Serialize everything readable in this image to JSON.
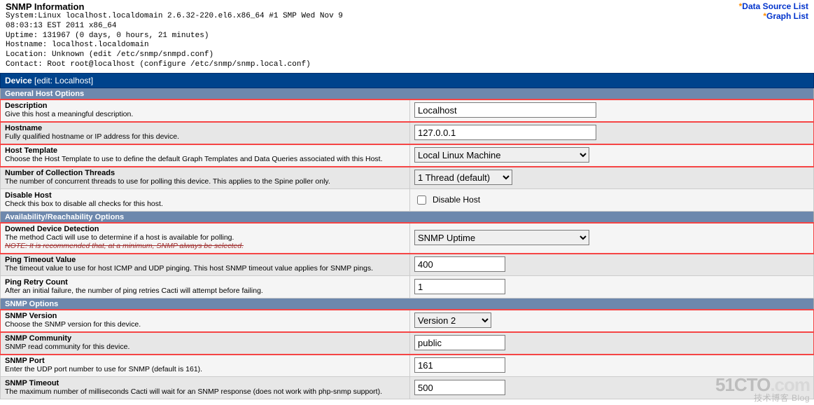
{
  "top_links": {
    "data_source_list": "Data Source List",
    "graph_list": "Graph List"
  },
  "snmp": {
    "title": "SNMP Information",
    "system_line1": "System:Linux localhost.localdomain 2.6.32-220.el6.x86_64 #1 SMP Wed Nov 9",
    "system_line2": "08:03:13 EST 2011 x86_64",
    "uptime": "Uptime: 131967 (0 days, 0 hours, 21 minutes)",
    "hostname": "Hostname: localhost.localdomain",
    "location": "Location: Unknown (edit /etc/snmp/snmpd.conf)",
    "contact": "Contact: Root root@localhost (configure /etc/snmp/snmp.local.conf)"
  },
  "device_bar": {
    "prefix": "Device ",
    "edit": "[edit: Localhost]"
  },
  "sections": {
    "general": "General Host Options",
    "avail": "Availability/Reachability Options",
    "snmp": "SNMP Options"
  },
  "fields": {
    "description": {
      "label": "Description",
      "hint": "Give this host a meaningful description.",
      "value": "Localhost"
    },
    "hostname": {
      "label": "Hostname",
      "hint": "Fully qualified hostname or IP address for this device.",
      "value": "127.0.0.1"
    },
    "host_template": {
      "label": "Host Template",
      "hint": "Choose the Host Template to use to define the default Graph Templates and Data Queries associated with this Host.",
      "value": "Local Linux Machine"
    },
    "threads": {
      "label": "Number of Collection Threads",
      "hint": "The number of concurrent threads to use for polling this device. This applies to the Spine poller only.",
      "value": "1 Thread (default)"
    },
    "disable": {
      "label": "Disable Host",
      "hint": "Check this box to disable all checks for this host.",
      "cb_label": "Disable Host"
    },
    "downed": {
      "label": "Downed Device Detection",
      "hint": "The method Cacti will use to determine if a host is available for polling.",
      "note": "NOTE: It is recommended that, at a minimum, SNMP always be selected.",
      "value": "SNMP Uptime"
    },
    "ping_timeout": {
      "label": "Ping Timeout Value",
      "hint": "The timeout value to use for host ICMP and UDP pinging. This host SNMP timeout value applies for SNMP pings.",
      "value": "400"
    },
    "ping_retry": {
      "label": "Ping Retry Count",
      "hint": "After an initial failure, the number of ping retries Cacti will attempt before failing.",
      "value": "1"
    },
    "snmp_version": {
      "label": "SNMP Version",
      "hint": "Choose the SNMP version for this device.",
      "value": "Version 2"
    },
    "snmp_community": {
      "label": "SNMP Community",
      "hint": "SNMP read community for this device.",
      "value": "public"
    },
    "snmp_port": {
      "label": "SNMP Port",
      "hint": "Enter the UDP port number to use for SNMP (default is 161).",
      "value": "161"
    },
    "snmp_timeout": {
      "label": "SNMP Timeout",
      "hint": "The maximum number of milliseconds Cacti will wait for an SNMP response (does not work with php-snmp support).",
      "value": "500"
    }
  },
  "watermark": {
    "big1": "51CTO",
    "big2": ".com",
    "sub": "技术博客   Blog"
  }
}
